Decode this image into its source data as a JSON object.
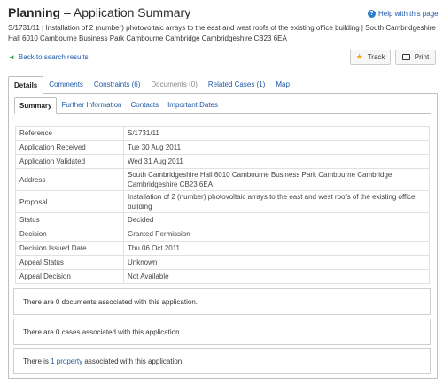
{
  "header": {
    "title_bold": "Planning",
    "title_rest": " – Application Summary",
    "help_label": "Help with this page",
    "summary": "S/1731/11 | Installation of 2 (number) photovoltaic arrays to the east and west roofs of the existing office building | South Cambridgeshire Hall 6010 Cambourne Business Park Cambourne Cambridge Cambridgeshire CB23 6EA"
  },
  "nav": {
    "back_label": "Back to search results"
  },
  "buttons": {
    "track_label": "Track",
    "print_label": "Print"
  },
  "tabs": [
    {
      "label": "Details",
      "state": "active"
    },
    {
      "label": "Comments",
      "state": "link"
    },
    {
      "label": "Constraints (6)",
      "state": "link"
    },
    {
      "label": "Documents (0)",
      "state": "disabled"
    },
    {
      "label": "Related Cases (1)",
      "state": "link"
    },
    {
      "label": "Map",
      "state": "link"
    }
  ],
  "subtabs": [
    {
      "label": "Summary",
      "state": "active"
    },
    {
      "label": "Further Information",
      "state": "link"
    },
    {
      "label": "Contacts",
      "state": "link"
    },
    {
      "label": "Important Dates",
      "state": "link"
    }
  ],
  "details": [
    {
      "key": "Reference",
      "value": "S/1731/11",
      "lines": 1
    },
    {
      "key": "Application Received",
      "value": "Tue 30 Aug 2011",
      "lines": 1
    },
    {
      "key": "Application Validated",
      "value": "Wed 31 Aug 2011",
      "lines": 1
    },
    {
      "key": "Address",
      "value": "South Cambridgeshire Hall 6010 Cambourne Business Park Cambourne Cambridge Cambridgeshire CB23 6EA",
      "lines": 2
    },
    {
      "key": "Proposal",
      "value": "Installation of 2 (number) photovoltaic arrays to the east and west roofs of the existing office building",
      "lines": 2
    },
    {
      "key": "Status",
      "value": "Decided",
      "lines": 1
    },
    {
      "key": "Decision",
      "value": "Granted Permission",
      "lines": 1
    },
    {
      "key": "Decision Issued Date",
      "value": "Thu 06 Oct 2011",
      "lines": 1
    },
    {
      "key": "Appeal Status",
      "value": "Unknown",
      "lines": 1
    },
    {
      "key": "Appeal Decision",
      "value": "Not Available",
      "lines": 1
    }
  ],
  "info": {
    "documents": "There are 0 documents associated with this application.",
    "cases": "There are 0 cases associated with this application.",
    "property_prefix": "There is ",
    "property_link": "1 property",
    "property_suffix": " associated with this application."
  },
  "colors": {
    "link": "#1f5aa8",
    "star": "#f0a21a",
    "back_arrow": "#2e9a3b",
    "help_circle": "#2a7fc9"
  }
}
